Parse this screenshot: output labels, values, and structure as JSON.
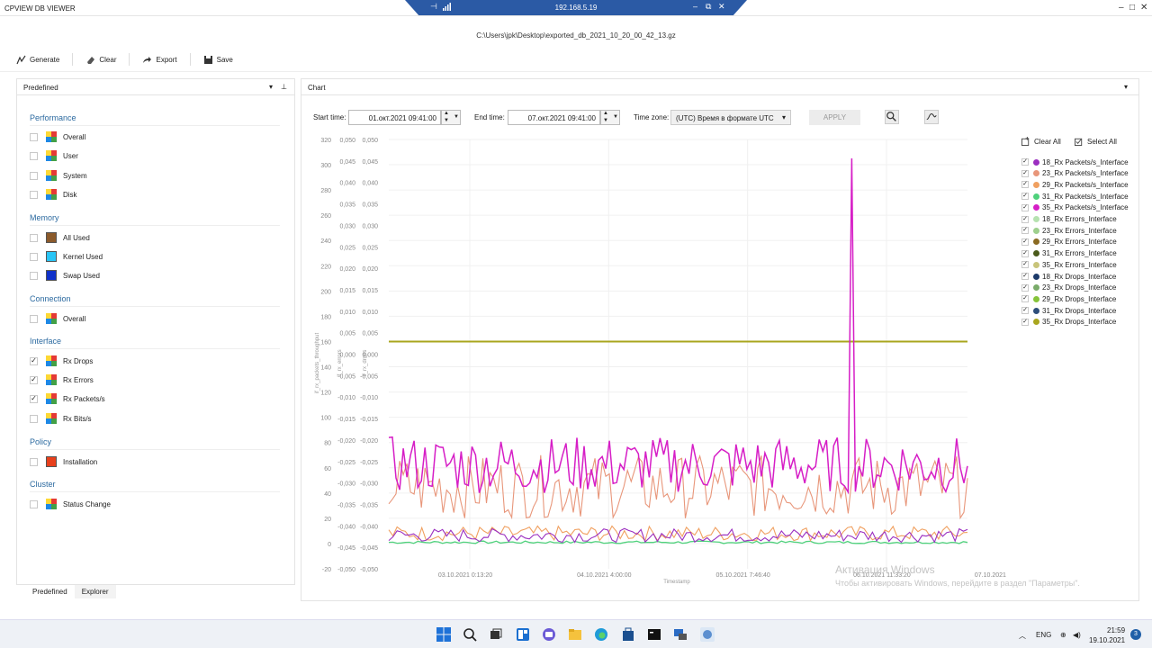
{
  "window": {
    "app_title": "CPVIEW DB VIEWER",
    "remote_host": "192.168.5.19",
    "file_path": "C:\\Users\\jpk\\Desktop\\exported_db_2021_10_20_00_42_13.gz"
  },
  "toolbar": {
    "generate": "Generate",
    "clear": "Clear",
    "export": "Export",
    "save": "Save"
  },
  "left_panel": {
    "title": "Predefined",
    "groups": [
      {
        "name": "Performance",
        "items": [
          {
            "label": "Overall",
            "checked": false,
            "icon": "palette"
          },
          {
            "label": "User",
            "checked": false,
            "icon": "palette"
          },
          {
            "label": "System",
            "checked": false,
            "icon": "palette"
          },
          {
            "label": "Disk",
            "checked": false,
            "icon": "palette"
          }
        ]
      },
      {
        "name": "Memory",
        "items": [
          {
            "label": "All Used",
            "checked": false,
            "color": "#8b5a2b"
          },
          {
            "label": "Kernel Used",
            "checked": false,
            "color": "#29c5f6"
          },
          {
            "label": "Swap Used",
            "checked": false,
            "color": "#1132c9"
          }
        ]
      },
      {
        "name": "Connection",
        "items": [
          {
            "label": "Overall",
            "checked": false,
            "icon": "palette"
          }
        ]
      },
      {
        "name": "Interface",
        "items": [
          {
            "label": "Rx Drops",
            "checked": true,
            "icon": "palette"
          },
          {
            "label": "Rx Errors",
            "checked": true,
            "icon": "palette"
          },
          {
            "label": "Rx Packets/s",
            "checked": true,
            "icon": "palette"
          },
          {
            "label": "Rx Bits/s",
            "checked": false,
            "icon": "palette"
          }
        ]
      },
      {
        "name": "Policy",
        "items": [
          {
            "label": "Installation",
            "checked": false,
            "color": "#e8401c"
          }
        ]
      },
      {
        "name": "Cluster",
        "items": [
          {
            "label": "Status Change",
            "checked": false,
            "icon": "palette"
          }
        ]
      }
    ],
    "tabs": [
      "Predefined",
      "Explorer"
    ]
  },
  "chart_panel": {
    "title": "Chart",
    "start_label": "Start time:",
    "start_value": "01.окт.2021 09:41:00",
    "end_label": "End time:",
    "end_value": "07.окт.2021 09:41:00",
    "tz_label": "Time zone:",
    "tz_value": "(UTC) Время в формате UTC",
    "apply_label": "APPLY",
    "clear_all": "Clear All",
    "select_all": "Select All"
  },
  "chart_data": {
    "type": "line",
    "y_axes": [
      {
        "label": "if_rx_packets_throughput",
        "ylim": [
          -20,
          320
        ],
        "ticks": [
          "320",
          "300",
          "280",
          "260",
          "240",
          "220",
          "200",
          "180",
          "160",
          "140",
          "120",
          "100",
          "80",
          "60",
          "40",
          "20",
          "0",
          "-20"
        ]
      },
      {
        "label": "if_rx_errors",
        "ylim": [
          -0.05,
          0.05
        ],
        "ticks": [
          "0,050",
          "0,045",
          "0,040",
          "0,035",
          "0,030",
          "0,025",
          "0,020",
          "0,015",
          "0,010",
          "0,005",
          "0,000",
          "-0,005",
          "-0,010",
          "-0,015",
          "-0,020",
          "-0,025",
          "-0,030",
          "-0,035",
          "-0,040",
          "-0,045",
          "-0,050"
        ]
      },
      {
        "label": "if_rx_drops",
        "ylim": [
          -0.05,
          0.05
        ],
        "ticks": [
          "0,050",
          "0,045",
          "0,040",
          "0,035",
          "0,030",
          "0,025",
          "0,020",
          "0,015",
          "0,010",
          "0,005",
          "0,000",
          "-0,005",
          "-0,010",
          "-0,015",
          "-0,020",
          "-0,025",
          "-0,030",
          "-0,035",
          "-0,040",
          "-0,045",
          "-0,050"
        ]
      }
    ],
    "x_label": "Timestamp",
    "x_ticks": [
      "03.10.2021 0:13:20",
      "04.10.2021 4:00:00",
      "05.10.2021 7:46:40",
      "06.10.2021 11:33:20",
      "07.10.2021 15:20:00"
    ],
    "series": [
      {
        "name": "18_Rx Packets/s_Interface",
        "color": "#9b2fc0",
        "checked": true
      },
      {
        "name": "23_Rx Packets/s_Interface",
        "color": "#e8967a",
        "checked": true
      },
      {
        "name": "29_Rx Packets/s_Interface",
        "color": "#f0a060",
        "checked": true
      },
      {
        "name": "31_Rx Packets/s_Interface",
        "color": "#4fd17c",
        "checked": true
      },
      {
        "name": "35_Rx Packets/s_Interface",
        "color": "#d61ec6",
        "checked": true
      },
      {
        "name": "18_Rx Errors_Interface",
        "color": "#b6e2b0",
        "checked": true
      },
      {
        "name": "23_Rx Errors_Interface",
        "color": "#9ed08e",
        "checked": true
      },
      {
        "name": "29_Rx Errors_Interface",
        "color": "#8a6a22",
        "checked": true
      },
      {
        "name": "31_Rx Errors_Interface",
        "color": "#4a5a1a",
        "checked": true
      },
      {
        "name": "35_Rx Errors_Interface",
        "color": "#c8c47a",
        "checked": true
      },
      {
        "name": "18_Rx Drops_Interface",
        "color": "#1c3a6a",
        "checked": true
      },
      {
        "name": "23_Rx Drops_Interface",
        "color": "#7aab6a",
        "checked": true
      },
      {
        "name": "29_Rx Drops_Interface",
        "color": "#86c43a",
        "checked": true
      },
      {
        "name": "31_Rx Drops_Interface",
        "color": "#2e4e7a",
        "checked": true
      },
      {
        "name": "35_Rx Drops_Interface",
        "color": "#a9a61e",
        "checked": true
      }
    ],
    "approx_values": {
      "pink_series_35_baseline": [
        40,
        85
      ],
      "pink_series_35_peak": 305,
      "orange_series_23_baseline": [
        20,
        70
      ],
      "low_series_baseline": [
        0,
        10
      ],
      "errors_and_drops": 0
    }
  },
  "watermark": {
    "line1": "Активация Windows",
    "line2": "Чтобы активировать Windows, перейдите в раздел \"Параметры\"."
  },
  "taskbar": {
    "lang": "ENG",
    "time": "21:59",
    "date": "19.10.2021",
    "notifications": "3"
  }
}
